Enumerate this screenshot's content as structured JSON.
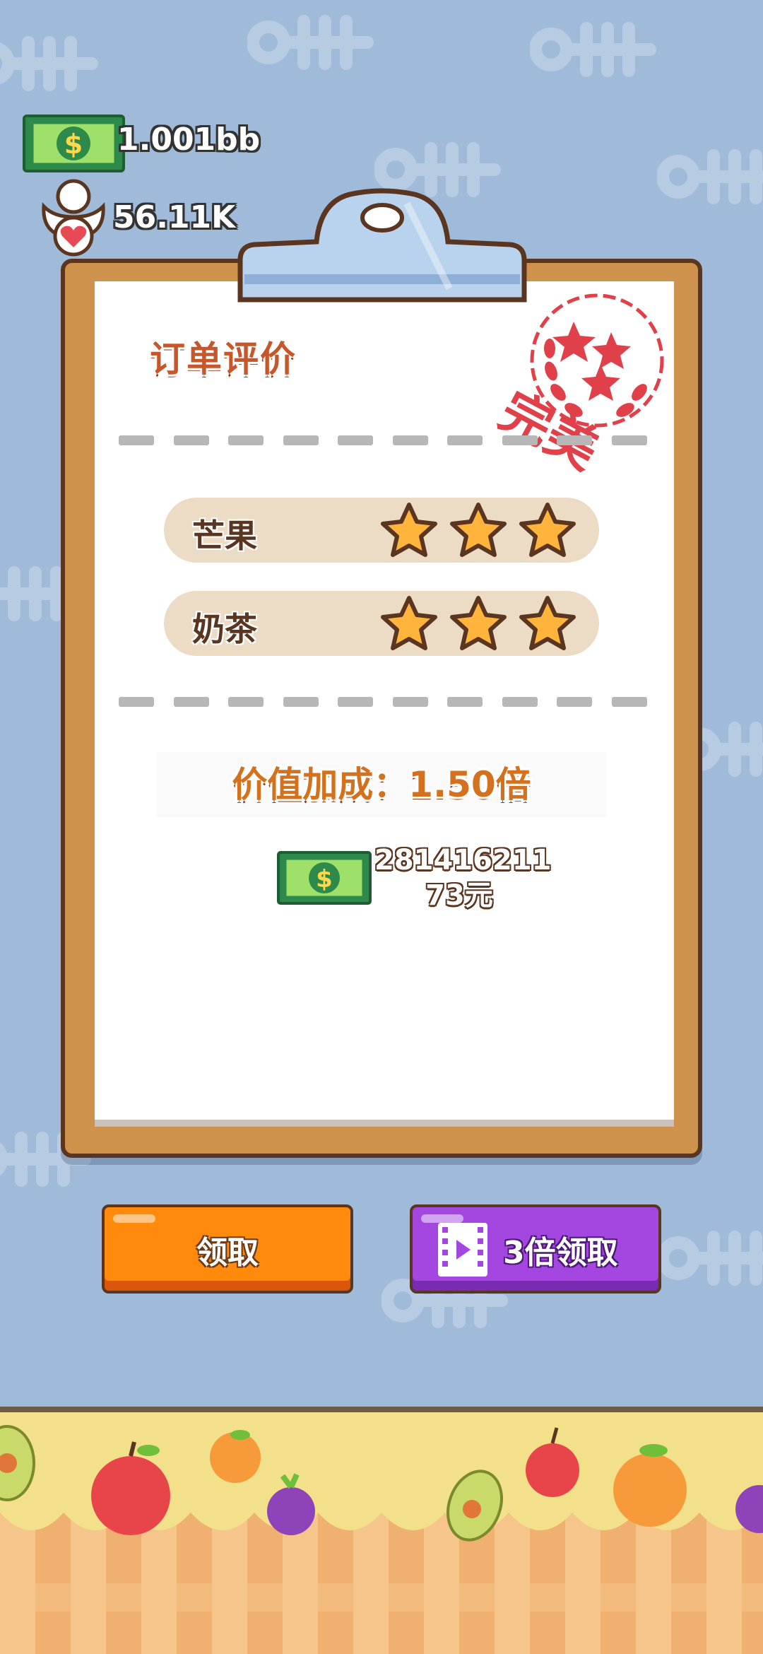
{
  "hud": {
    "money_value": "1.001bb",
    "fans_value": "56.11K",
    "money_icon": "dollar-bill-icon",
    "fans_icon": "fan-heart-icon"
  },
  "order": {
    "title": "订单评价",
    "stamp_text": "完美",
    "items": [
      {
        "label": "芒果",
        "stars": 3
      },
      {
        "label": "奶茶",
        "stars": 3
      }
    ],
    "bonus_text": "价值加成：1.50倍",
    "reward_line1": "281416211",
    "reward_line2": "73元"
  },
  "buttons": {
    "claim_label": "领取",
    "triple_label": "3倍领取"
  },
  "colors": {
    "background": "#9fbbd9",
    "board": "#cf924d",
    "orange_button": "#ff8a0c",
    "purple_button": "#a446e0",
    "star": "#ffb43c",
    "stamp": "#e0404a"
  }
}
